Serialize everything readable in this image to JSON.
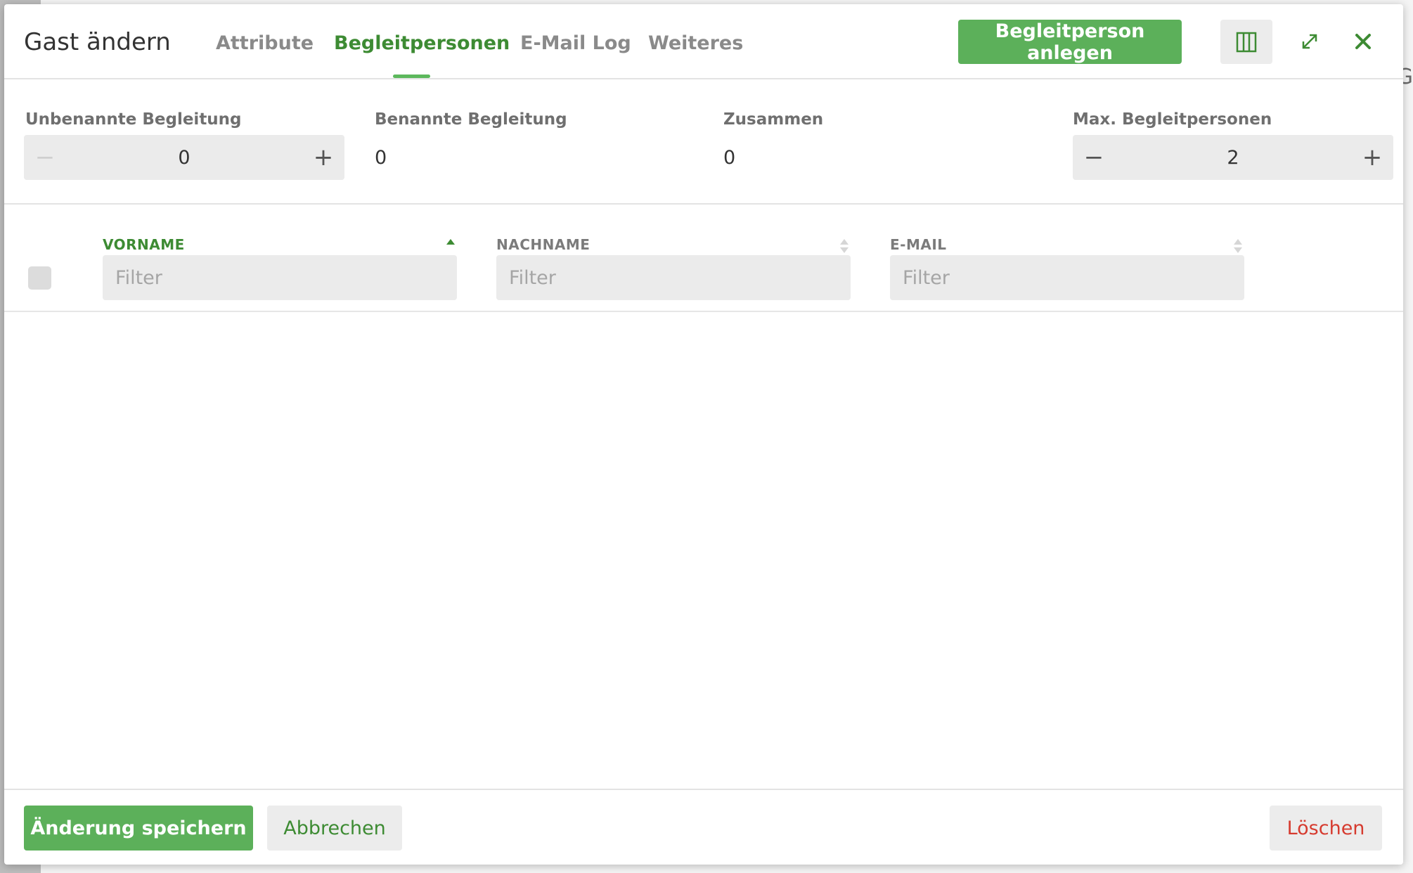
{
  "modal": {
    "title": "Gast ändern",
    "tabs": [
      {
        "label": "Attribute",
        "active": false
      },
      {
        "label": "Begleitpersonen",
        "active": true
      },
      {
        "label": "E-Mail Log",
        "active": false
      },
      {
        "label": "Weiteres",
        "active": false
      }
    ],
    "add_button": "Begleitperson anlegen",
    "icons": {
      "columns": "columns-icon",
      "expand": "expand-icon",
      "close": "close-icon"
    }
  },
  "counters": {
    "unnamed": {
      "label": "Unbenannte Begleitung",
      "value": "0",
      "minus": "−",
      "plus": "+"
    },
    "named": {
      "label": "Benannte Begleitung",
      "value": "0"
    },
    "total": {
      "label": "Zusammen",
      "value": "0"
    },
    "max": {
      "label": "Max. Begleitpersonen",
      "value": "2",
      "minus": "−",
      "plus": "+"
    }
  },
  "table": {
    "columns": [
      {
        "header": "VORNAME",
        "sorted": "asc",
        "filter_placeholder": "Filter"
      },
      {
        "header": "NACHNAME",
        "sorted": "none",
        "filter_placeholder": "Filter"
      },
      {
        "header": "E-MAIL",
        "sorted": "none",
        "filter_placeholder": "Filter"
      }
    ],
    "rows": []
  },
  "footer": {
    "save": "Änderung speichern",
    "cancel": "Abbrechen",
    "delete": "Löschen"
  },
  "colors": {
    "accent": "#5cb05a",
    "accent_text": "#3d8b33",
    "danger": "#d63b2f",
    "field_bg": "#ebebeb"
  },
  "background": {
    "partial_text": "G"
  }
}
